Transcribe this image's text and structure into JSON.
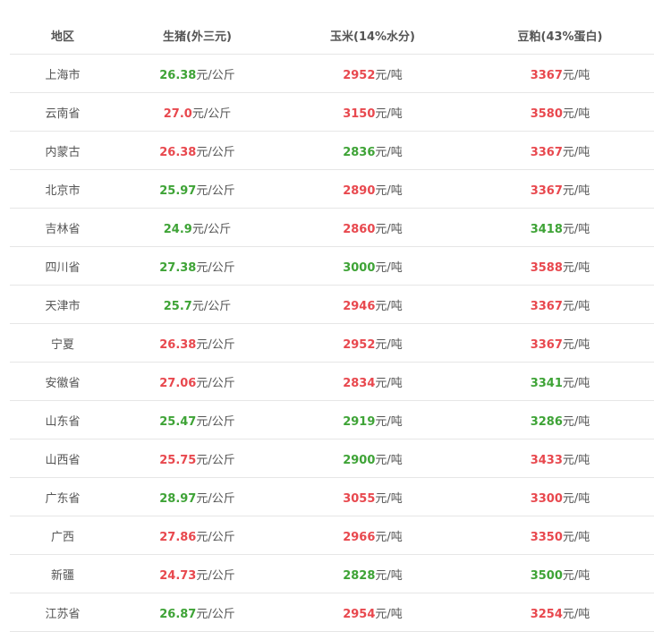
{
  "colors": {
    "up": "#e8484e",
    "down": "#3ea336",
    "text": "#555555",
    "border": "#e6e6e6"
  },
  "headers": [
    "地区",
    "生猪(外三元)",
    "玉米(14%水分)",
    "豆粕(43%蛋白)"
  ],
  "units": {
    "pig": "元/公斤",
    "corn": "元/吨",
    "meal": "元/吨"
  },
  "rows": [
    {
      "region": "上海市",
      "pig": "26.38",
      "pig_trend": "green",
      "corn": "2952",
      "corn_trend": "red",
      "meal": "3367",
      "meal_trend": "red"
    },
    {
      "region": "云南省",
      "pig": "27.0",
      "pig_trend": "red",
      "corn": "3150",
      "corn_trend": "red",
      "meal": "3580",
      "meal_trend": "red"
    },
    {
      "region": "内蒙古",
      "pig": "26.38",
      "pig_trend": "red",
      "corn": "2836",
      "corn_trend": "green",
      "meal": "3367",
      "meal_trend": "red"
    },
    {
      "region": "北京市",
      "pig": "25.97",
      "pig_trend": "green",
      "corn": "2890",
      "corn_trend": "red",
      "meal": "3367",
      "meal_trend": "red"
    },
    {
      "region": "吉林省",
      "pig": "24.9",
      "pig_trend": "green",
      "corn": "2860",
      "corn_trend": "red",
      "meal": "3418",
      "meal_trend": "green"
    },
    {
      "region": "四川省",
      "pig": "27.38",
      "pig_trend": "green",
      "corn": "3000",
      "corn_trend": "green",
      "meal": "3588",
      "meal_trend": "red"
    },
    {
      "region": "天津市",
      "pig": "25.7",
      "pig_trend": "green",
      "corn": "2946",
      "corn_trend": "red",
      "meal": "3367",
      "meal_trend": "red"
    },
    {
      "region": "宁夏",
      "pig": "26.38",
      "pig_trend": "red",
      "corn": "2952",
      "corn_trend": "red",
      "meal": "3367",
      "meal_trend": "red"
    },
    {
      "region": "安徽省",
      "pig": "27.06",
      "pig_trend": "red",
      "corn": "2834",
      "corn_trend": "red",
      "meal": "3341",
      "meal_trend": "green"
    },
    {
      "region": "山东省",
      "pig": "25.47",
      "pig_trend": "green",
      "corn": "2919",
      "corn_trend": "green",
      "meal": "3286",
      "meal_trend": "green"
    },
    {
      "region": "山西省",
      "pig": "25.75",
      "pig_trend": "red",
      "corn": "2900",
      "corn_trend": "green",
      "meal": "3433",
      "meal_trend": "red"
    },
    {
      "region": "广东省",
      "pig": "28.97",
      "pig_trend": "green",
      "corn": "3055",
      "corn_trend": "red",
      "meal": "3300",
      "meal_trend": "red"
    },
    {
      "region": "广西",
      "pig": "27.86",
      "pig_trend": "red",
      "corn": "2966",
      "corn_trend": "red",
      "meal": "3350",
      "meal_trend": "red"
    },
    {
      "region": "新疆",
      "pig": "24.73",
      "pig_trend": "red",
      "corn": "2828",
      "corn_trend": "green",
      "meal": "3500",
      "meal_trend": "green"
    },
    {
      "region": "江苏省",
      "pig": "26.87",
      "pig_trend": "green",
      "corn": "2954",
      "corn_trend": "red",
      "meal": "3254",
      "meal_trend": "red"
    }
  ]
}
